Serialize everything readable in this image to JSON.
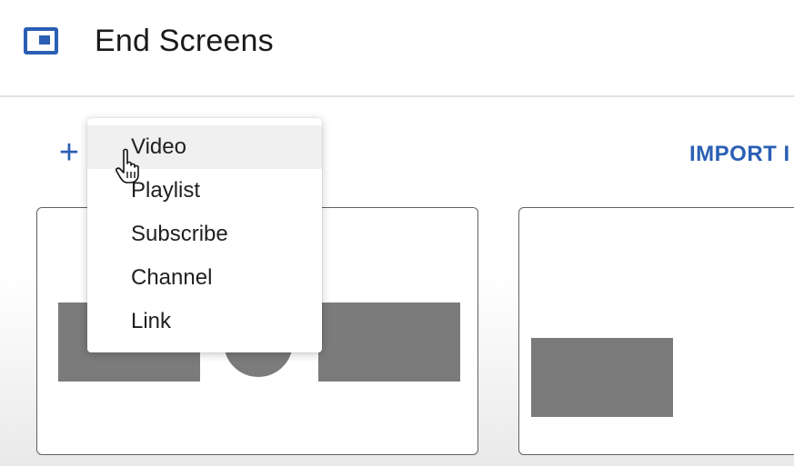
{
  "header": {
    "icon": "end-screen-icon",
    "title": "End Screens"
  },
  "toolbar": {
    "add_label": "+",
    "add_icon": "plus-icon",
    "import_label": "IMPORT I"
  },
  "menu": {
    "items": [
      {
        "label": "Video",
        "hovered": true
      },
      {
        "label": "Playlist"
      },
      {
        "label": "Subscribe"
      },
      {
        "label": "Channel"
      },
      {
        "label": "Link"
      }
    ]
  },
  "templates": {
    "count_visible": 2
  },
  "colors": {
    "accent": "#2a5fb4",
    "placeholder": "#7b7b7b",
    "menu_hover": "#f0f0f0"
  },
  "cursor": {
    "icon": "hand-pointer-cursor-icon"
  }
}
